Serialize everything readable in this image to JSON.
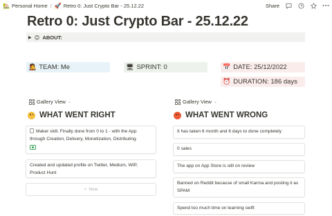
{
  "topbar": {
    "crumbs": [
      {
        "emoji": "🏡",
        "label": "Personal Home"
      },
      {
        "emoji": "🚀",
        "label": "Retro 0: Just Crypto Bar - 25.12.22"
      }
    ],
    "separator": "/",
    "share_label": "Share",
    "icons": [
      "comment-icon",
      "clock-icon",
      "star-icon",
      "more-icon"
    ]
  },
  "page": {
    "title": "Retro 0: Just Crypto Bar - 25.12.22",
    "about": {
      "emoji": "😊",
      "label": "ABOUT:"
    }
  },
  "properties": {
    "team": {
      "emoji": "🧑‍🎤",
      "label": "TEAM: Me",
      "color": "#e7f3f8"
    },
    "sprint": {
      "emoji": "🖥",
      "label": "SPRINT: 0",
      "color": "#edf3ec"
    },
    "date": {
      "emoji": "📅",
      "label": "DATE: 25/12/2022",
      "color": "#fbecec"
    },
    "duration": {
      "emoji": "⏰",
      "label": "DURATION: 186 days",
      "color": "#fbecec"
    }
  },
  "gallery_left": {
    "view_label": "Gallery View",
    "heading": "WHAT WENT RIGHT",
    "cards": [
      {
        "text": "Maker skill. Finally done from 0 to 1 - with the App through Creation, Delivery, Monetization, Distributing"
      },
      {
        "text": "Created and updated profile on Twitter, Medium, WIP, Product Hunt"
      }
    ],
    "new_label": "New"
  },
  "gallery_right": {
    "view_label": "Gallery View",
    "heading": "WHAT WENT WRONG",
    "cards": [
      {
        "text": "It has taken 6 month and 6 days to done completely"
      },
      {
        "text": "0 sales"
      },
      {
        "text": "The app on App Store is still on review"
      },
      {
        "text": "Banned on Reddit because of small Karma and posting it as SPAM"
      },
      {
        "text": "Spend too much time on learning swift"
      }
    ]
  },
  "colors": {
    "accent_green": "#3aa55d",
    "happy_face": "#f6c142",
    "sad_face": "#ee5a35"
  }
}
